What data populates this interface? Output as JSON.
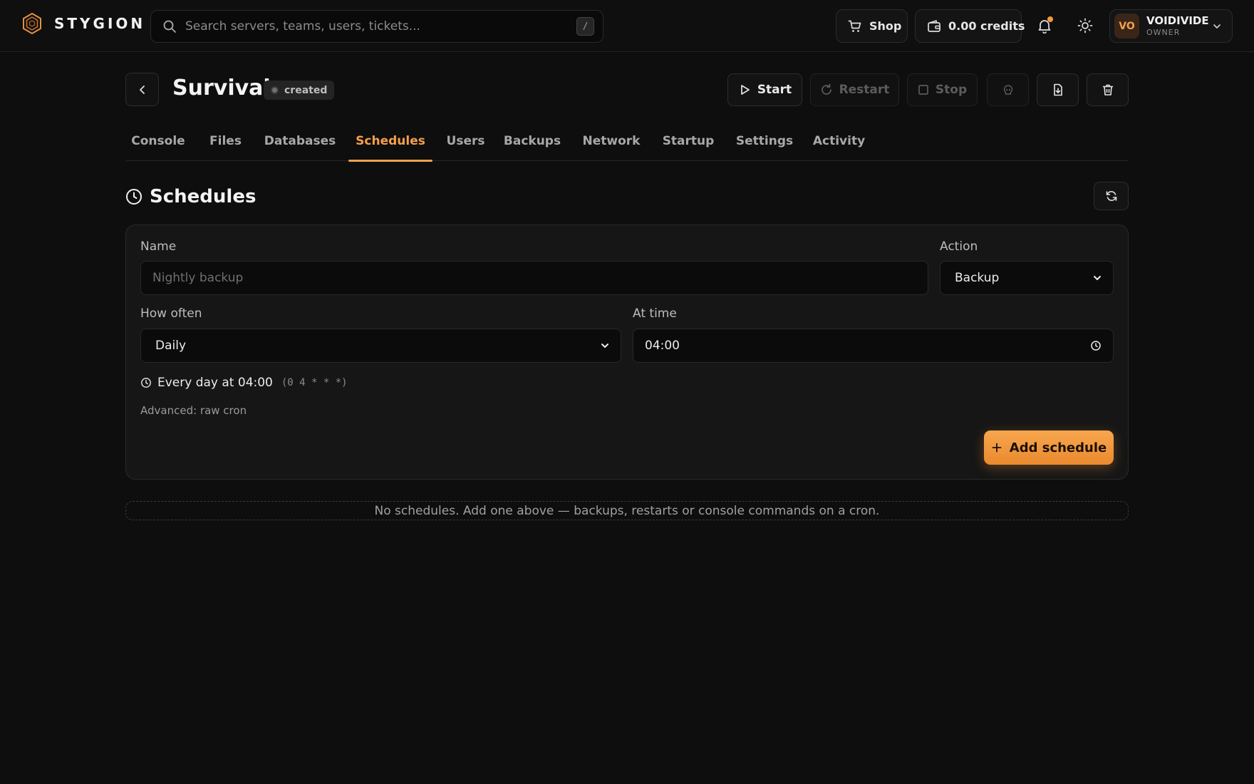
{
  "brand": {
    "name": "STYGION"
  },
  "search": {
    "placeholder": "Search servers, teams, users, tickets...",
    "shortcut": "/"
  },
  "topbar": {
    "shop_label": "Shop",
    "credits_label": "0.00 credits",
    "user": {
      "initials": "VO",
      "name": "VOIDIVIDE",
      "role": "OWNER"
    }
  },
  "server": {
    "name": "Survival",
    "status": "created",
    "actions": {
      "start": "Start",
      "restart": "Restart",
      "stop": "Stop"
    }
  },
  "tabs": [
    {
      "label": "Console"
    },
    {
      "label": "Files"
    },
    {
      "label": "Databases"
    },
    {
      "label": "Schedules",
      "active": true
    },
    {
      "label": "Users"
    },
    {
      "label": "Backups"
    },
    {
      "label": "Network"
    },
    {
      "label": "Startup"
    },
    {
      "label": "Settings"
    },
    {
      "label": "Activity"
    }
  ],
  "section": {
    "title": "Schedules"
  },
  "form": {
    "name_label": "Name",
    "name_placeholder": "Nightly backup",
    "action_label": "Action",
    "action_value": "Backup",
    "often_label": "How often",
    "often_value": "Daily",
    "time_label": "At time",
    "time_value": "04:00",
    "summary": "Every day at 04:00",
    "cron_expr": "(0 4 * * *)",
    "advanced_label": "Advanced: raw cron",
    "submit_label": "Add schedule"
  },
  "empty_state": "No schedules. Add one above — backups, restarts or console commands on a cron.",
  "colors": {
    "accent": "#f5a04d",
    "background": "#0e0e0e",
    "card": "#161616"
  }
}
